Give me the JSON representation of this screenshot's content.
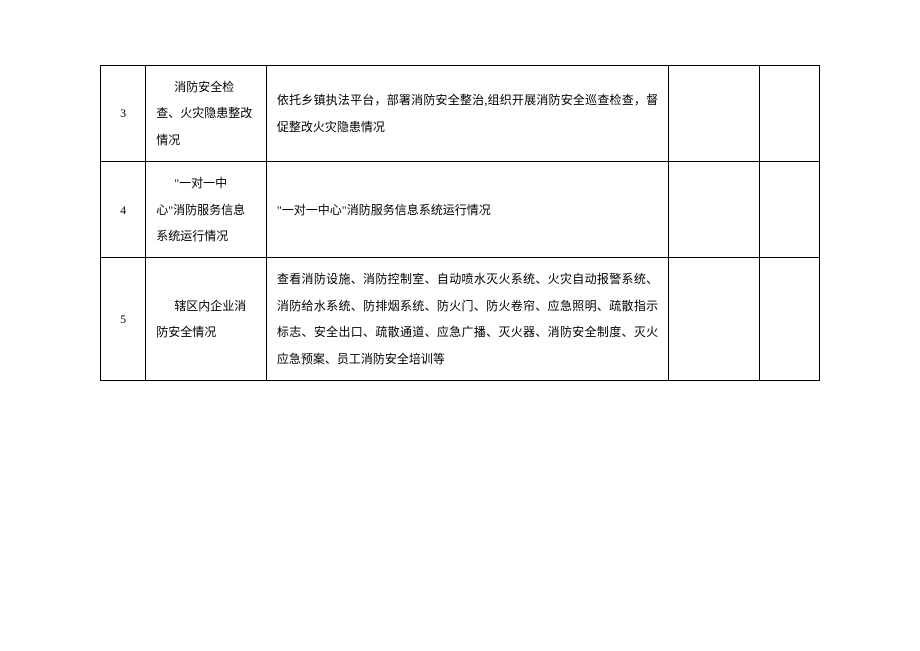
{
  "table": {
    "rows": [
      {
        "num": "3",
        "item": "消防安全检查、火灾隐患整改情况",
        "desc": "依托乡镇执法平台，部署消防安全整治,组织开展消防安全巡查检查，督促整改火灾隐患情况",
        "blank1": "",
        "blank2": ""
      },
      {
        "num": "4",
        "item": "\"一对一中心\"消防服务信息系统运行情况",
        "desc": "\"一对一中心\"消防服务信息系统运行情况",
        "blank1": "",
        "blank2": ""
      },
      {
        "num": "5",
        "item": "辖区内企业消防安全情况",
        "desc": "查看消防设施、消防控制室、自动喷水灭火系统、火灾自动报警系统、消防给水系统、防排烟系统、防火门、防火卷帘、应急照明、疏散指示标志、安全出口、疏散通道、应急广播、灭火器、消防安全制度、灭火应急预案、员工消防安全培训等",
        "blank1": "",
        "blank2": ""
      }
    ]
  }
}
